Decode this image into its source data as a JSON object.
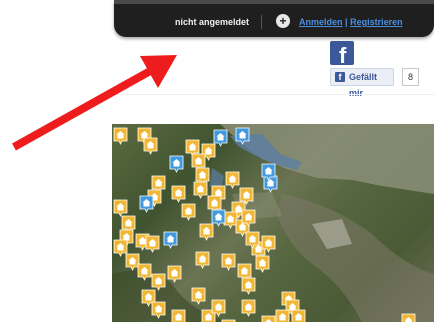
{
  "userbar": {
    "login_status": "nicht angemeldet",
    "login_link": "Anmelden",
    "link_separator": "|",
    "register_link": "Registrieren",
    "plus_icon": "+"
  },
  "facebook": {
    "logo_letter": "f",
    "like_label": "Gefällt mir",
    "like_count": "8"
  },
  "colors": {
    "pin_yellow": "#f2b732",
    "pin_blue": "#3f9ae0",
    "arrow": "#ee1c1c",
    "link": "#4a90e2",
    "fb_blue": "#3b5998"
  },
  "map": {
    "yellow_pin_count": 53,
    "blue_pin_count": 8
  }
}
